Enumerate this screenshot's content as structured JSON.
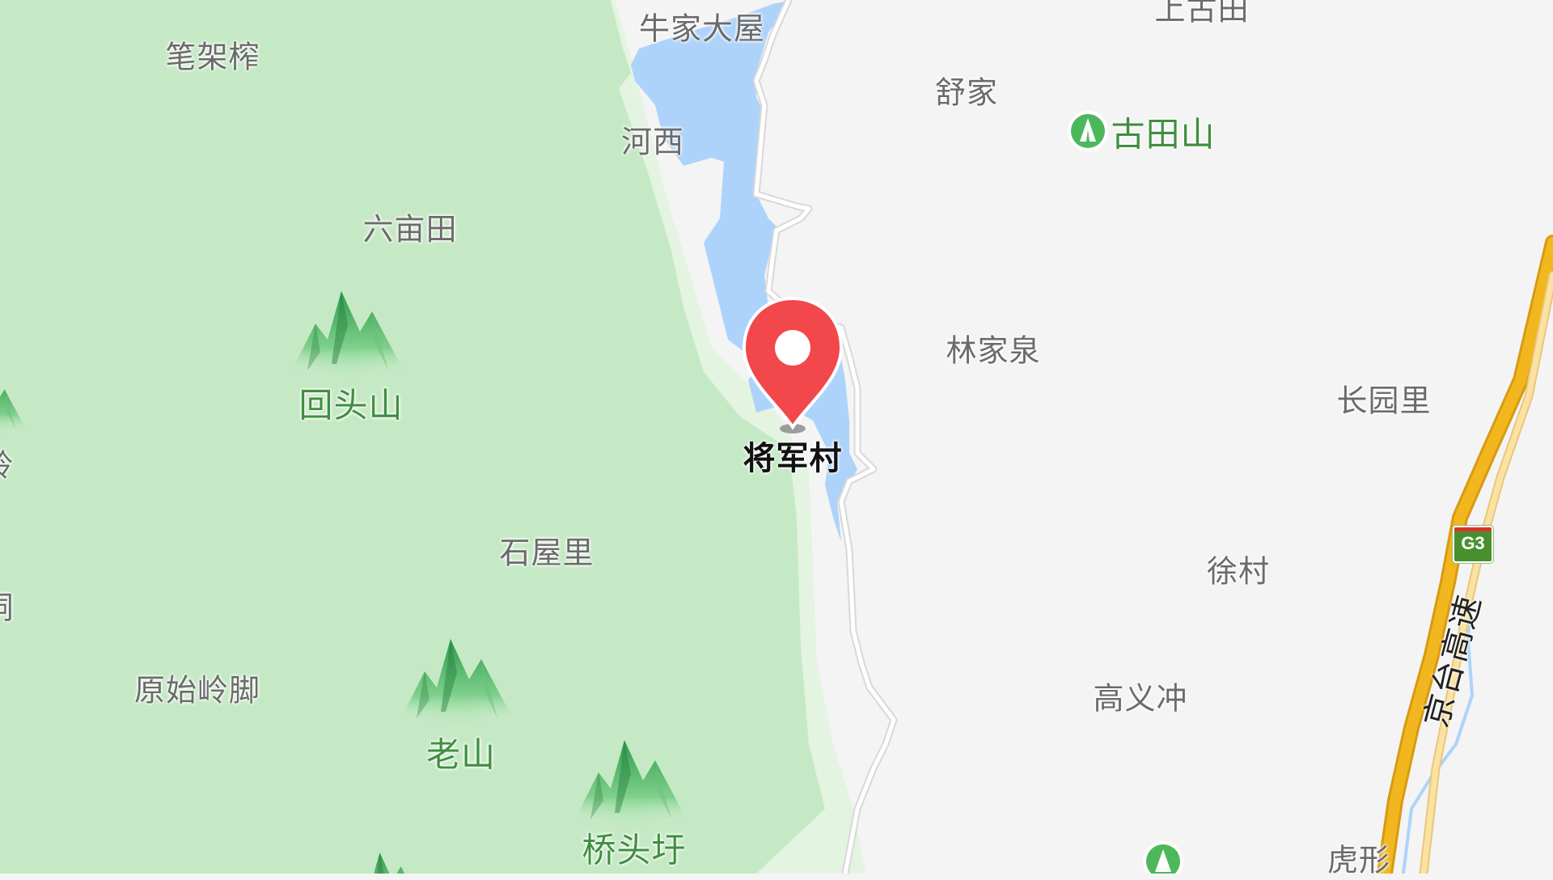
{
  "map": {
    "colors": {
      "land": "#f4f4f4",
      "forest": "#c6e9c5",
      "forest_edge": "#e3f4e1",
      "water": "#aed3fb",
      "highway": "#f2b61f",
      "highway_casing": "#d79a12",
      "pin": "#f2474b",
      "mountain_label": "#3f8f3f"
    },
    "marker": {
      "label": "将军村",
      "icon": "location-pin-icon"
    },
    "places": {
      "niujiadawu": "牛家大屋",
      "shanggutian": "上古田",
      "bijiazha": "笔架榨",
      "shujia": "舒家",
      "hexi": "河西",
      "liumutian": "六亩田",
      "linjiaquan": "林家泉",
      "changyuanli": "长园里",
      "shiwuli": "石屋里",
      "xucun": "徐村",
      "yuanshilingjiao": "原始岭脚",
      "gaoyichong": "高义冲",
      "huxing": "虎形"
    },
    "mountains": {
      "gutianshan": "古田山",
      "huitoushan": "回头山",
      "laoshan": "老山",
      "qiaotouqian": "桥头圩"
    },
    "partial_labels": {
      "left_edge_1": "岭",
      "left_edge_2": "洞"
    },
    "highway": {
      "shield_label": "G3",
      "name": "京台高速"
    }
  }
}
